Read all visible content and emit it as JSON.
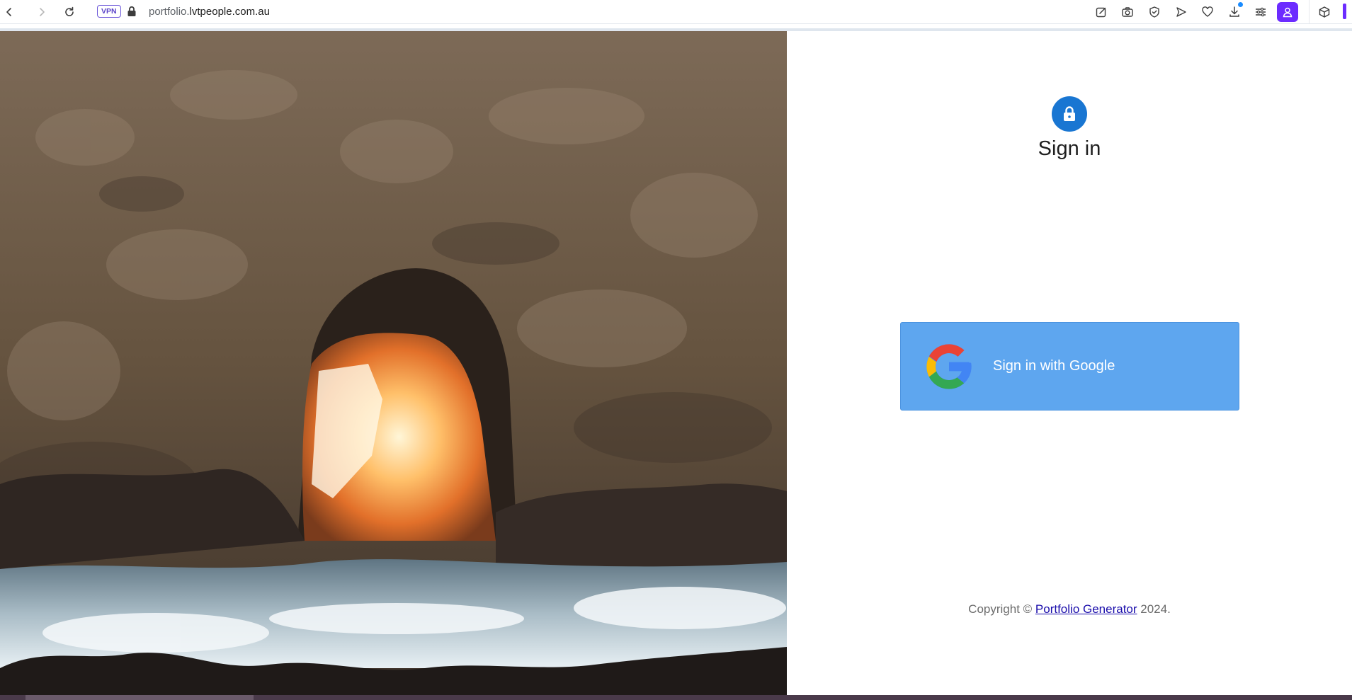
{
  "browser": {
    "url_subdomain": "portfolio.",
    "url_domain": "lvtpeople.com.au",
    "vpn_label": "VPN",
    "icons": [
      "back-icon",
      "forward-icon",
      "reload-icon",
      "lock-icon",
      "edit-icon",
      "camera-icon",
      "shield-check-icon",
      "send-icon",
      "heart-icon",
      "download-icon",
      "menu-lines-icon",
      "profile-icon",
      "cube-icon"
    ],
    "accent_color": "#6c2cff"
  },
  "signin": {
    "title": "Sign in",
    "google_button_label": "Sign in with Google",
    "button_color": "#5ea6ef",
    "avatar_color": "#1976d2"
  },
  "footer": {
    "prefix": "Copyright © ",
    "link_text": "Portfolio Generator",
    "suffix": " 2024."
  }
}
